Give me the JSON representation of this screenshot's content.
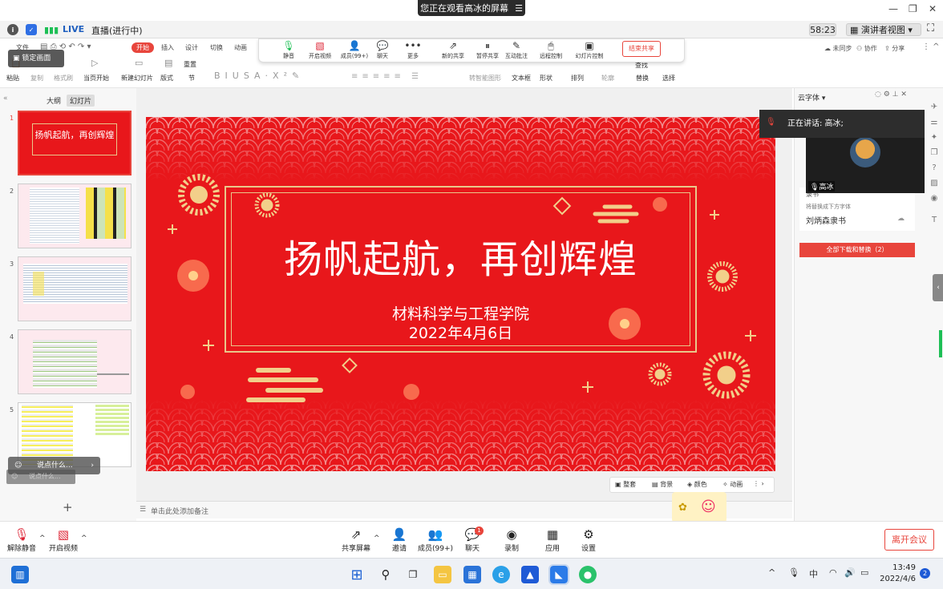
{
  "banner": {
    "text": "您正在观看高冰的屏幕"
  },
  "statusbar": {
    "live": "LIVE",
    "live_text": "直播(进行中)",
    "timer": "58:23",
    "view_mode": "演讲者视图"
  },
  "ribbon": {
    "tabs": [
      "文件",
      "开始",
      "插入",
      "设计",
      "切换",
      "动画"
    ],
    "right_actions": [
      "未同步",
      "协作",
      "分享"
    ],
    "tools": {
      "paste": "粘贴",
      "copy": "复制",
      "format_painter": "格式刷",
      "play": "当页开始",
      "new_slide": "新建幻灯片",
      "layout": "版式",
      "reset": "重置",
      "section": "节",
      "textbox": "文本框",
      "shape": "形状",
      "arrange": "排列",
      "outline": "轮廓",
      "replace": "替换",
      "select": "选择",
      "find": "查找",
      "smart_shape": "转智能图形"
    }
  },
  "lock_screen": "锁定画面",
  "meeting_toolbar": {
    "items": [
      {
        "label": "静音",
        "icon": "mic-icon"
      },
      {
        "label": "开启视频",
        "icon": "camera-off-icon"
      },
      {
        "label": "成员(99+)",
        "icon": "members-icon"
      },
      {
        "label": "聊天",
        "icon": "chat-icon"
      },
      {
        "label": "更多",
        "icon": "more-icon"
      },
      {
        "label": "新的共享",
        "icon": "share-icon"
      },
      {
        "label": "暂停共享",
        "icon": "pause-icon"
      },
      {
        "label": "互动批注",
        "icon": "annotate-icon"
      },
      {
        "label": "远程控制",
        "icon": "remote-icon"
      },
      {
        "label": "幻灯片控制",
        "icon": "slide-control-icon"
      }
    ],
    "end_share": "结束共享"
  },
  "left_panel": {
    "tabs": [
      "大纲",
      "幻灯片"
    ],
    "slide_numbers": [
      "1",
      "2",
      "3",
      "4",
      "5"
    ],
    "add": "+"
  },
  "thumb1": {
    "title": "扬帆起航，再创辉煌"
  },
  "slide": {
    "title": "扬帆起航，再创辉煌",
    "subtitle1": "材料科学与工程学院",
    "subtitle2": "2022年4月6日",
    "colors": {
      "background": "#e8171b",
      "gold": "#e9c78a",
      "flower": "#f2cf8a"
    }
  },
  "slide_toolbar": [
    "整套",
    "背景",
    "颜色",
    "动画"
  ],
  "notes": {
    "placeholder": "单击此处添加备注"
  },
  "right_panel": {
    "header": "云字体",
    "speaker": "正在讲话: 高冰;",
    "video_name": "高冰",
    "font_hint_label": "隶书",
    "font_hint": "将替换成下方字体",
    "font_name": "刘炳森隶书",
    "download_btn": "全部下载和替换（2）"
  },
  "chat": {
    "placeholder": "说点什么...",
    "placeholder2": "说点什么..."
  },
  "bottom_bar": {
    "unmute": "解除静音",
    "video": "开启视频",
    "items": [
      {
        "label": "共享屏幕",
        "icon": "share-screen-icon"
      },
      {
        "label": "邀请",
        "icon": "invite-icon"
      },
      {
        "label": "成员(99+)",
        "icon": "members-icon"
      },
      {
        "label": "聊天",
        "icon": "chat-icon"
      },
      {
        "label": "录制",
        "icon": "record-icon"
      },
      {
        "label": "应用",
        "icon": "apps-icon"
      },
      {
        "label": "设置",
        "icon": "settings-icon"
      }
    ],
    "chat_badge": "1",
    "leave": "离开会议"
  },
  "taskbar": {
    "time": "13:49",
    "date": "2022/4/6",
    "ime": "中",
    "notif_count": "2"
  }
}
